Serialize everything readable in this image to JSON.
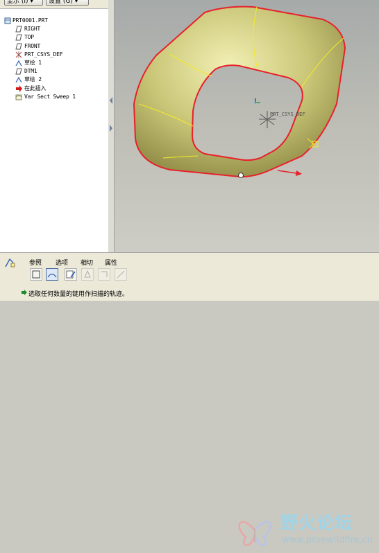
{
  "toolbar": {
    "display_label": "显示 (I) ▾",
    "settings_label": "设置 (G) ▾"
  },
  "model_tree": {
    "items": [
      {
        "label": "PRT0001.PRT",
        "icon": "part-icon"
      },
      {
        "label": "RIGHT",
        "icon": "datum-plane-icon"
      },
      {
        "label": "TOP",
        "icon": "datum-plane-icon"
      },
      {
        "label": "FRONT",
        "icon": "datum-plane-icon"
      },
      {
        "label": "PRT_CSYS_DEF",
        "icon": "csys-icon"
      },
      {
        "label": "草绘 1",
        "icon": "sketch-icon"
      },
      {
        "label": "DTM1",
        "icon": "datum-plane-icon"
      },
      {
        "label": "草绘 2",
        "icon": "sketch-icon"
      },
      {
        "label": "在此插入",
        "icon": "insert-arrow-icon"
      },
      {
        "label": "Var Sect Sweep 1",
        "icon": "sweep-feature-icon"
      }
    ]
  },
  "viewport": {
    "csys_label": "PRT_CSYS_DEF",
    "trajectory_color": "#e8202a",
    "surface_color": "#c9c577"
  },
  "dashboard": {
    "tabs": [
      "参照",
      "选项",
      "相切",
      "属性"
    ],
    "message": "选取任何数量的链用作扫描的轨迹。"
  },
  "watermark": {
    "title": "野火论坛",
    "url": "www.proewildfire.cn"
  }
}
